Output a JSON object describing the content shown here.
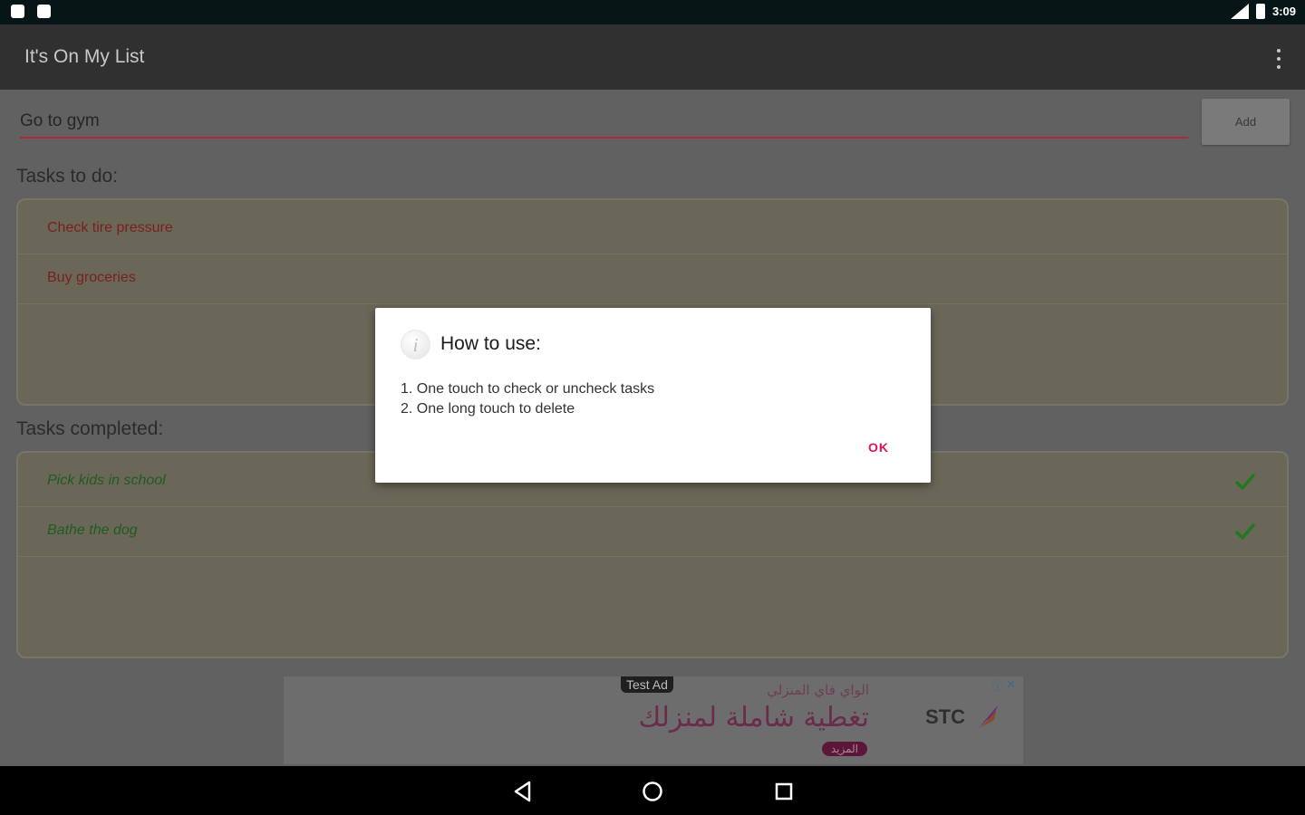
{
  "status_bar": {
    "time": "3:09",
    "icons": [
      "notification-icon",
      "notification-icon",
      "signal-icon",
      "battery-icon"
    ]
  },
  "app_bar": {
    "title": "It's On My List",
    "menu_icon": "overflow-menu-icon"
  },
  "task_input": {
    "value": "Go to gym",
    "add_label": "Add"
  },
  "todo": {
    "label": "Tasks to do:",
    "items": [
      "Check tire pressure",
      "Buy groceries"
    ]
  },
  "completed": {
    "label": "Tasks completed:",
    "items": [
      "Pick kids in school",
      "Bathe the dog"
    ],
    "check_icon": "checkmark-icon"
  },
  "ad": {
    "badge": "Test Ad",
    "headline": "الواي فاي المنزلي",
    "text": "تغطية شاملة لمنزلك",
    "button": "المزيد",
    "brand": "STC",
    "close": "✕",
    "info": "ⓘ"
  },
  "dialog": {
    "icon_glyph": "i",
    "title": "How to use:",
    "line1": "1. One touch to check or uncheck tasks",
    "line2": "2. One long touch to delete",
    "ok": "OK"
  },
  "nav": {
    "icons": [
      "back-icon",
      "home-icon",
      "recents-icon"
    ]
  },
  "colors": {
    "status_bar": "#061616",
    "app_bar": "#303030",
    "accent": "#e0115f",
    "todo_text": "#b02a2a",
    "done_text": "#2e8b2e",
    "check": "#3aa83a"
  }
}
